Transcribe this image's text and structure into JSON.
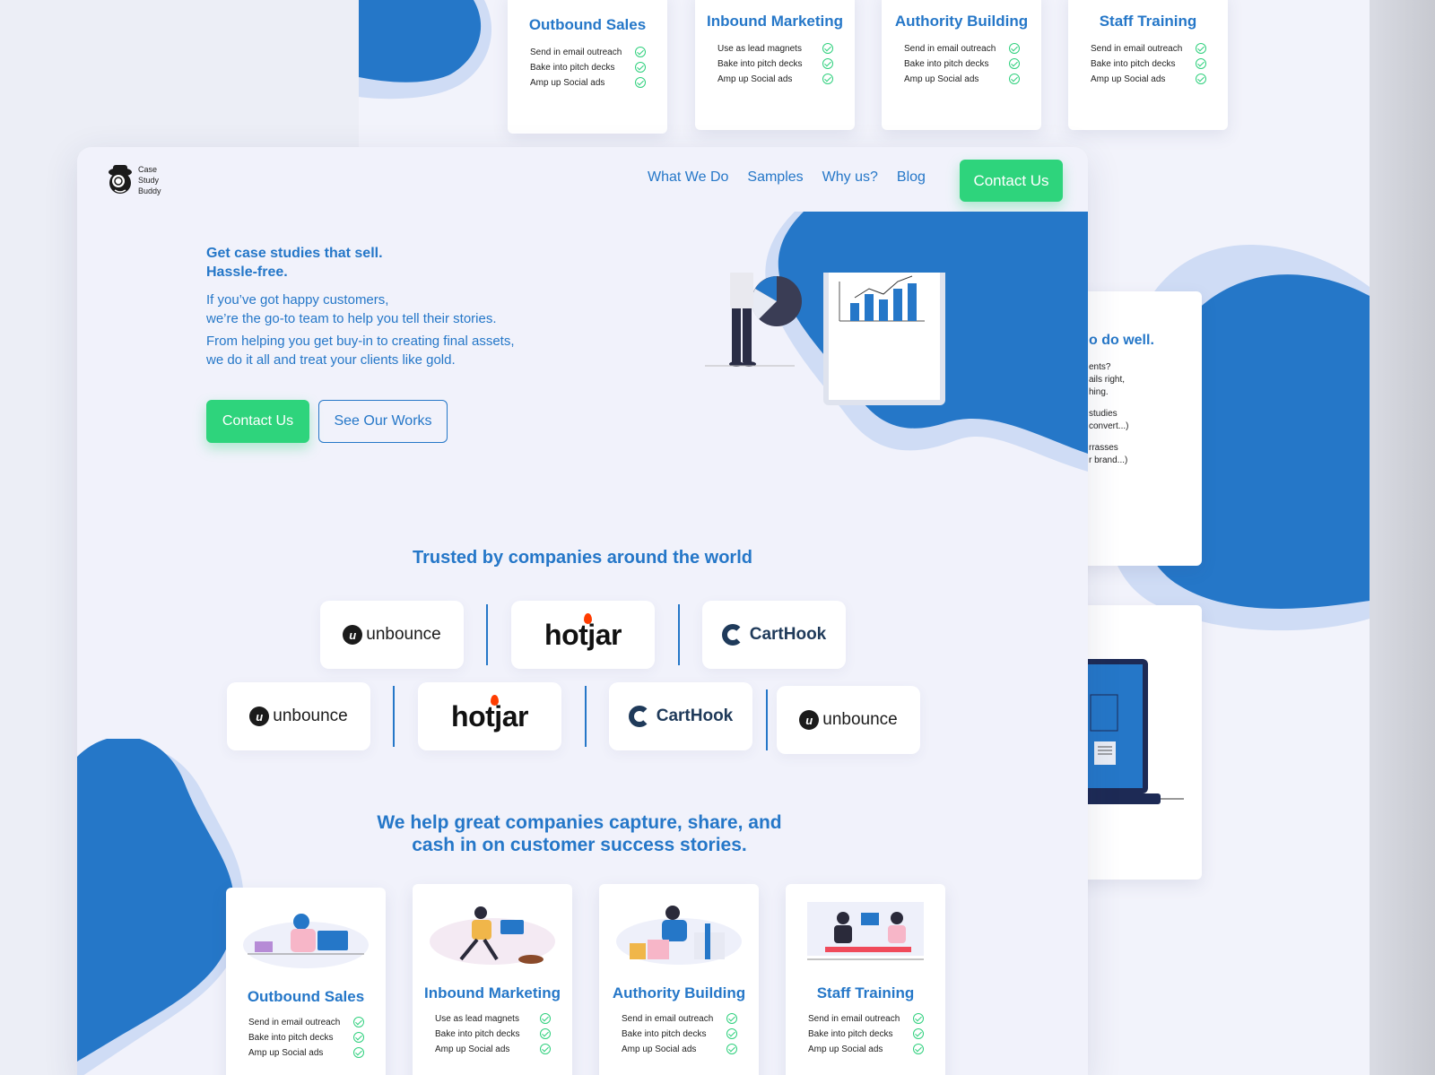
{
  "colors": {
    "brand_blue": "#2577c8",
    "cta_green": "#2ed47c",
    "page_bg": "#f1f2fb",
    "check_green": "#2fd07d"
  },
  "logo": {
    "icon": "detective-mascot-icon",
    "line1": "Case",
    "line2": "Study",
    "line3": "Buddy"
  },
  "nav": {
    "items": [
      "What We Do",
      "Samples",
      "Why us?",
      "Blog"
    ],
    "cta": "Contact Us"
  },
  "hero": {
    "title_line1": "Get case studies that sell.",
    "title_line2": "Hassle-free.",
    "sub_line1": "If you’ve got happy customers,",
    "sub_line2": "we’re the go-to team to help you tell their stories.",
    "sub_line3": "From helping you get buy-in to creating final assets,",
    "sub_line4": "we do it all and treat your clients like gold.",
    "primary_button": "Contact Us",
    "secondary_button": "See Our Works"
  },
  "trusted": {
    "title": "Trusted by companies around the world",
    "logos_row1": [
      "unbounce",
      "hotjar",
      "CartHook"
    ],
    "logos_row2": [
      "unbounce",
      "hotjar",
      "CartHook",
      "unbounce"
    ]
  },
  "services": {
    "title_line1": "We help great companies capture, share, and",
    "title_line2": "cash in on customer success stories.",
    "cards": [
      {
        "title": "Outbound Sales",
        "items": [
          "Send in email outreach",
          "Bake into pitch decks",
          "Amp up Social ads"
        ]
      },
      {
        "title": "Inbound Marketing",
        "items": [
          "Use as lead magnets",
          "Bake into pitch decks",
          "Amp up Social ads"
        ]
      },
      {
        "title": "Authority Building",
        "items": [
          "Send in email outreach",
          "Bake into pitch decks",
          "Amp up Social ads"
        ]
      },
      {
        "title": "Staff Training",
        "items": [
          "Send in email outreach",
          "Bake into pitch decks",
          "Amp up Social ads"
        ]
      }
    ]
  },
  "background_page": {
    "side_card_heading": "o do well.",
    "side_card_lines": [
      "ents?",
      "ails right,",
      "hing.",
      "studies",
      "convert...)",
      "rrasses",
      "r brand...)"
    ]
  }
}
